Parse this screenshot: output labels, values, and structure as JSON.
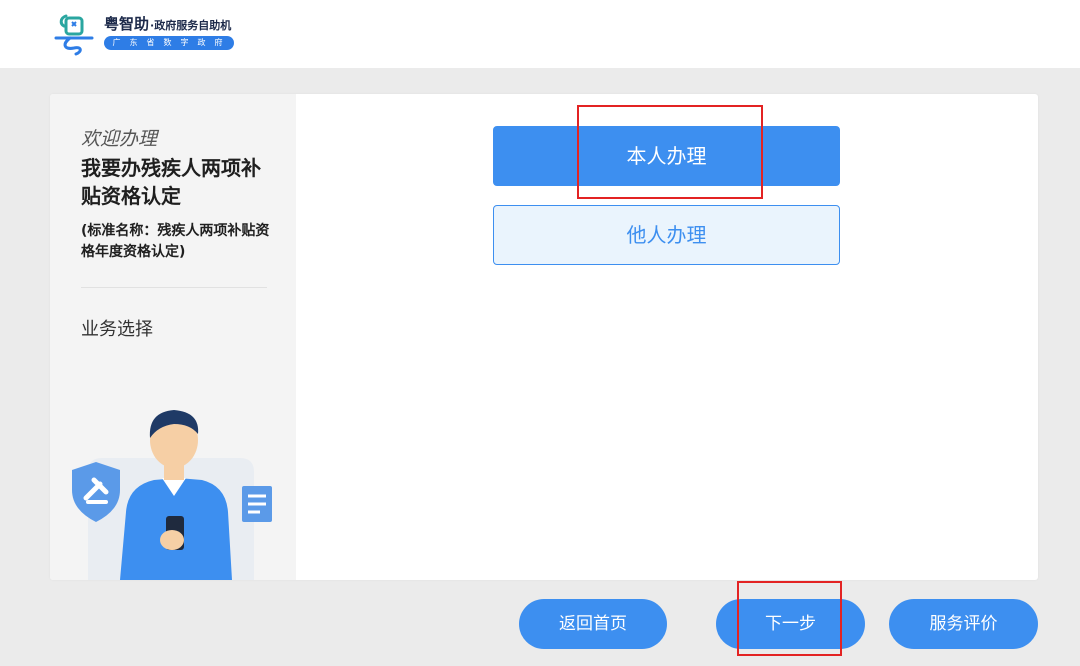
{
  "header": {
    "logo_icon": "yue-logo-icon",
    "title": "粤智助",
    "subtitle": "·政府服务自助机",
    "tagline": "广东省数字政府"
  },
  "sidebar": {
    "welcome": "欢迎办理",
    "service_name": "我要办残疾人两项补贴资格认定",
    "standard_name": "(标准名称：残疾人两项补贴资格年度资格认定)",
    "current_step": "业务选择",
    "illustration": "person-with-phone-illustration"
  },
  "main": {
    "self_label": "本人办理",
    "other_label": "他人办理"
  },
  "footer": {
    "home_label": "返回首页",
    "next_label": "下一步",
    "rate_label": "服务评价"
  },
  "colors": {
    "accent": "#3d8ff0",
    "highlight_box": "#e32323",
    "background": "#ebebeb"
  }
}
